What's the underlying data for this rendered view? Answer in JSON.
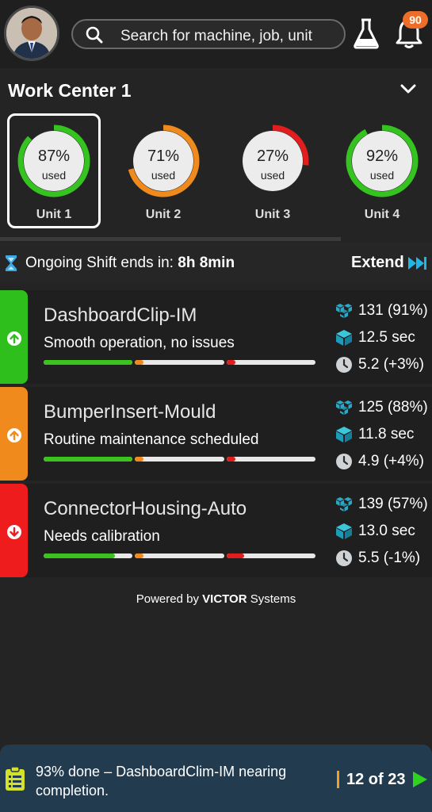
{
  "header": {
    "avatar_alt": "user avatar",
    "search": {
      "placeholder": "Search for machine, job, unit"
    },
    "notifications_count": "90"
  },
  "work_center": {
    "title": "Work Center 1",
    "units": [
      {
        "name": "Unit 1",
        "percent_label": "87%",
        "used_label": "used",
        "usage": 0.87,
        "color": "#35c41f",
        "selected": true
      },
      {
        "name": "Unit 2",
        "percent_label": "71%",
        "used_label": "used",
        "usage": 0.71,
        "color": "#f08a1c",
        "selected": false
      },
      {
        "name": "Unit 3",
        "percent_label": "27%",
        "used_label": "used",
        "usage": 0.27,
        "color": "#e11d1d",
        "selected": false
      },
      {
        "name": "Unit 4",
        "percent_label": "92%",
        "used_label": "used",
        "usage": 0.92,
        "color": "#35c41f",
        "selected": false
      }
    ]
  },
  "shift": {
    "label": "Ongoing Shift ends in:",
    "value": "8h 8min",
    "extend_label": "Extend"
  },
  "jobs": [
    {
      "name": "DashboardClip-IM",
      "status": "Smooth operation, no issues",
      "status_color": "#2fbf1d",
      "trend": "up",
      "progress": [
        1.0,
        0.1,
        0.1
      ],
      "count": "131 (91%)",
      "cycle_time": "12.5 sec",
      "time_delta": "5.2 (+3%)"
    },
    {
      "name": "BumperInsert-Mould",
      "status": "Routine maintenance scheduled",
      "status_color": "#f08a1c",
      "trend": "up",
      "progress": [
        1.0,
        0.1,
        0.1
      ],
      "count": "125 (88%)",
      "cycle_time": "11.8 sec",
      "time_delta": "4.9 (+4%)"
    },
    {
      "name": "ConnectorHousing-Auto",
      "status": "Needs calibration",
      "status_color": "#ee1c1c",
      "trend": "down",
      "progress": [
        0.8,
        0.1,
        0.2
      ],
      "count": "139 (57%)",
      "cycle_time": "13.0 sec",
      "time_delta": "5.5 (-1%)"
    }
  ],
  "powered_by": {
    "prefix": "Powered by",
    "brand": "VICTOR",
    "suffix": "Systems"
  },
  "footer": {
    "message": "93% done – DashboardClim-IM nearing completion.",
    "page": "12 of 23"
  },
  "colors": {
    "bar_green": "#3bc21f",
    "bar_orange": "#f08a1c",
    "bar_red": "#e11d1d",
    "metric_icon": "#2aa8c8"
  },
  "icons": [
    "search-icon",
    "flask-icon",
    "bell-icon",
    "chevron-down-icon",
    "hourglass-icon",
    "fast-forward-icon",
    "cubes-icon",
    "box-icon",
    "clock-icon",
    "arrow-up-circle-icon",
    "arrow-down-circle-icon",
    "clipboard-icon",
    "play-next-icon"
  ]
}
